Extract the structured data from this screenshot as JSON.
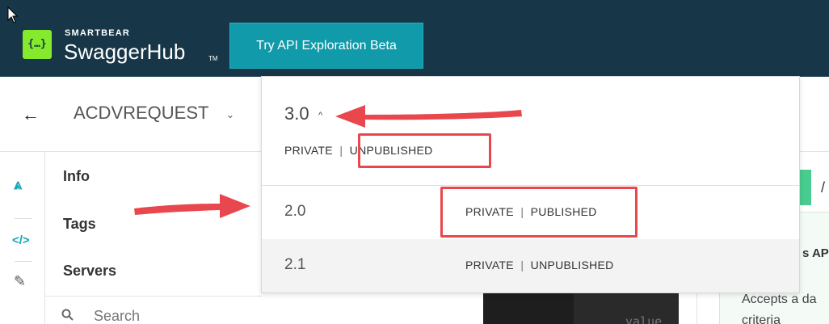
{
  "header": {
    "logo_glyph": "{…}",
    "brand_top": "SMARTBEAR",
    "brand_main": "SwaggerHub",
    "brand_tm": "TM",
    "try_button": "Try API Exploration Beta"
  },
  "subheader": {
    "back_glyph": "←",
    "api_name": "ACDVREQUEST",
    "api_chevron": "⌄"
  },
  "rail": {
    "icons": [
      "design-icon",
      "code-icon",
      "edit-icon"
    ],
    "glyphs": [
      "⩓",
      "</>",
      "✎"
    ]
  },
  "nav": {
    "items": [
      "Info",
      "Tags",
      "Servers"
    ],
    "search_placeholder": "Search"
  },
  "dropdown": {
    "current_version": "3.0",
    "current_caret": "^",
    "current_visibility": "PRIVATE",
    "separator": "|",
    "current_state": "UNPUBLISHED",
    "versions": [
      {
        "version": "2.0",
        "visibility": "PRIVATE",
        "separator": "|",
        "state": "PUBLISHED"
      },
      {
        "version": "2.1",
        "visibility": "PRIVATE",
        "separator": "|",
        "state": "UNPUBLISHED"
      }
    ]
  },
  "editor": {
    "value_text": "value"
  },
  "right_panel": {
    "button_partial": "/",
    "title_partial": "s AP",
    "text_line1": "Accepts a da",
    "text_line2": "criteria"
  },
  "colors": {
    "topbar": "#173647",
    "accent_button": "#119aa9",
    "logo_green": "#85ea2d",
    "highlight_red": "#e8474d",
    "method_green": "#49cc90"
  }
}
